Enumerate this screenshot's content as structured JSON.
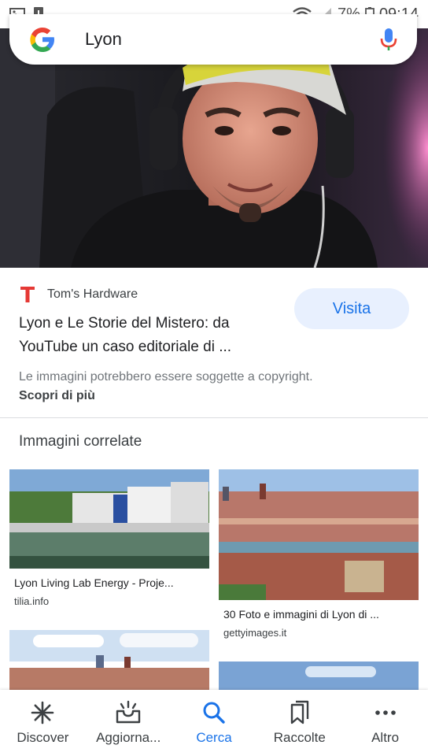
{
  "status_bar": {
    "battery": "7%",
    "time": "09:14"
  },
  "search": {
    "query": "Lyon"
  },
  "result": {
    "source_name": "Tom's Hardware",
    "visit_label": "Visita",
    "title_line1": "Lyon e Le Storie del Mistero: da",
    "title_line2": "YouTube un caso editoriale di ...",
    "copyright_notice": "Le immagini potrebbero essere soggette a copyright.",
    "learn_more": "Scopri di più"
  },
  "related": {
    "heading": "Immagini correlate",
    "items": [
      {
        "title": "Lyon Living Lab Energy - Proje...",
        "source": "tilia.info"
      },
      {
        "title": "30 Foto e immagini di Lyon di ...",
        "source": "gettyimages.it"
      }
    ]
  },
  "bottom_nav": {
    "items": [
      {
        "label": "Discover"
      },
      {
        "label": "Aggiorna..."
      },
      {
        "label": "Cerca"
      },
      {
        "label": "Raccolte"
      },
      {
        "label": "Altro"
      }
    ]
  },
  "colors": {
    "accent": "#1a73e8",
    "visit_bg": "#e8f0fe",
    "source_logo": "#e53935"
  }
}
